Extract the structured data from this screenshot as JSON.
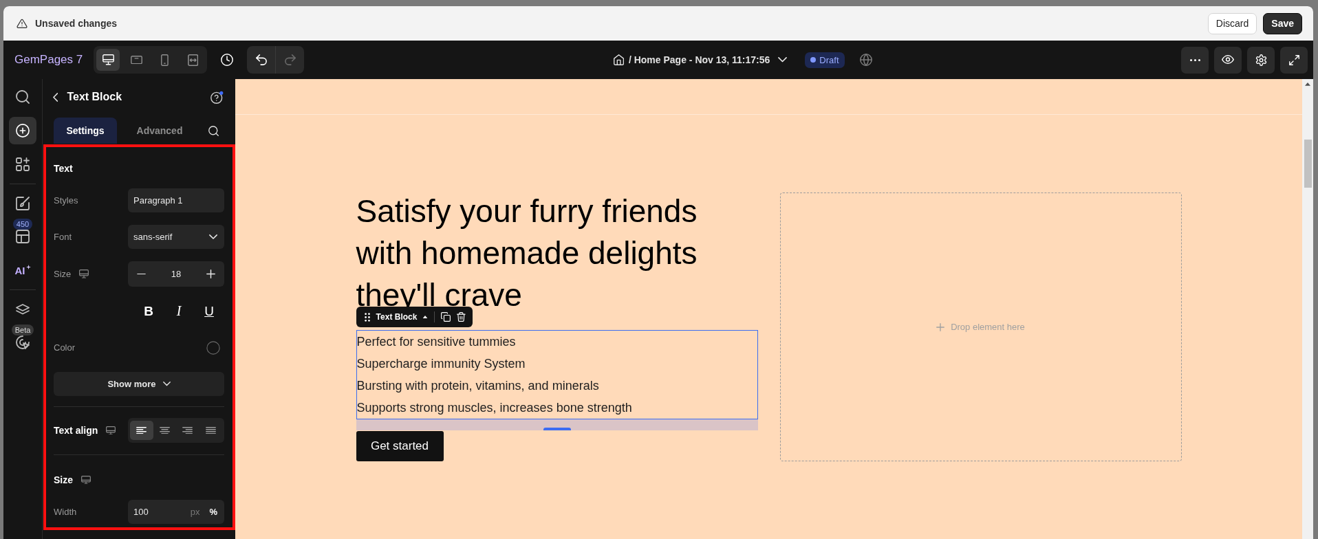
{
  "notification_bar": {
    "message": "Unsaved changes",
    "buttons": [
      {
        "label": "Discard",
        "kind": "discard"
      },
      {
        "label": "Save",
        "kind": "save"
      }
    ]
  },
  "toolbar": {
    "logo": "GemPages 7",
    "devices": [
      {
        "kind": "desktop",
        "selected": true
      },
      {
        "kind": "tablet",
        "selected": false
      },
      {
        "kind": "mobile",
        "selected": false
      },
      {
        "kind": "fit",
        "selected": false
      }
    ],
    "history": [
      {
        "kind": "undo",
        "disabled": false
      },
      {
        "kind": "redo",
        "disabled": true
      }
    ],
    "page": "/ Home Page - Nov 13, 11:17:56",
    "status": "Draft",
    "actions": [
      {
        "kind": "more"
      },
      {
        "kind": "preview"
      },
      {
        "kind": "settings"
      },
      {
        "kind": "fullscreen"
      }
    ]
  },
  "sidebar": {
    "groups": [
      {
        "items": [
          {
            "kind": "search",
            "selected": false
          },
          {
            "kind": "add",
            "selected": true
          },
          {
            "kind": "elements",
            "selected": false
          }
        ]
      },
      {
        "items": [
          {
            "kind": "theme",
            "selected": false
          },
          {
            "kind": "templates",
            "badge": "450",
            "selected": false
          },
          {
            "kind": "ai",
            "label": "AI",
            "selected": false
          }
        ]
      },
      {
        "items": [
          {
            "kind": "layers",
            "selected": false
          },
          {
            "kind": "heatmap",
            "badge": "Beta",
            "selected": false
          }
        ]
      }
    ]
  },
  "panel": {
    "title": "Text Block",
    "highlighted": true,
    "tabs": [
      {
        "label": "Settings",
        "selected": true
      },
      {
        "label": "Advanced",
        "selected": false
      }
    ],
    "sections": [
      {
        "kind": "fields",
        "title": "Text",
        "rows": [
          {
            "kind": "select",
            "label": "Styles",
            "value": "Paragraph 1"
          },
          {
            "kind": "dropdown",
            "label": "Font",
            "value": "sans-serif"
          },
          {
            "kind": "stepper",
            "label": "Size",
            "responsive": true,
            "value": "18"
          },
          {
            "kind": "format",
            "buttons": [
              {
                "kind": "bold",
                "label": "B"
              },
              {
                "kind": "italic",
                "label": "I"
              },
              {
                "kind": "underline",
                "label": "U"
              }
            ]
          },
          {
            "kind": "color",
            "label": "Color"
          },
          {
            "kind": "expander",
            "label": "Show more"
          }
        ]
      },
      {
        "kind": "align",
        "title": "Text align",
        "responsive": true,
        "options": [
          {
            "kind": "left",
            "selected": true
          },
          {
            "kind": "center",
            "selected": false
          },
          {
            "kind": "right",
            "selected": false
          },
          {
            "kind": "justify",
            "selected": false
          }
        ]
      },
      {
        "kind": "fields",
        "title": "Size",
        "responsive": true,
        "rows": [
          {
            "kind": "unit_input",
            "label": "Width",
            "value": "100",
            "units": [
              {
                "label": "px",
                "selected": false
              },
              {
                "label": "%",
                "selected": true
              }
            ]
          }
        ]
      }
    ]
  },
  "canvas": {
    "heading": "Satisfy your furry friends with homemade delights they'll crave",
    "selected_block": {
      "label": "Text Block",
      "lines": [
        "Perfect for sensitive tummies",
        "Supercharge immunity System",
        "Bursting with protein, vitamins, and minerals",
        "Supports strong muscles, increases bone strength"
      ]
    },
    "button": "Get started",
    "drop_zone": "Drop element here"
  }
}
